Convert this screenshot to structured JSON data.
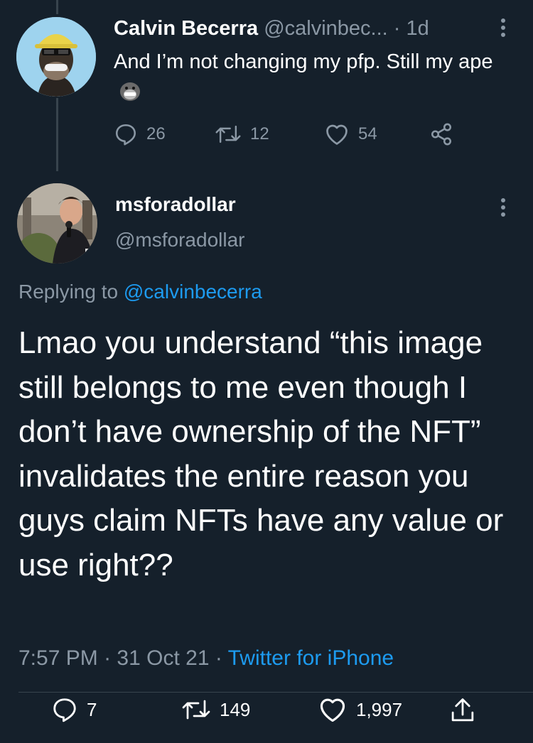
{
  "parent_tweet": {
    "display_name": "Calvin Becerra",
    "handle": "@calvinbec...",
    "separator": "·",
    "time": "1d",
    "text": "And I’m not changing my pfp. Still my ape",
    "stats": {
      "replies": "26",
      "retweets": "12",
      "likes": "54"
    }
  },
  "main_tweet": {
    "display_name": "msforadollar",
    "handle": "@msforadollar",
    "replying_prefix": "Replying to",
    "replying_handle": "@calvinbecerra",
    "text": "Lmao you understand “this image still belongs to me even though I don’t have ownership of the NFT” invalidates the entire reason you guys claim NFTs have any value or use right??",
    "time": "7:57 PM",
    "date": "31 Oct 21",
    "sep1": "·",
    "sep2": "·",
    "source": "Twitter for iPhone",
    "stats": {
      "replies": "7",
      "retweets": "149",
      "likes": "1,997"
    }
  },
  "icons": {
    "reply": "reply-icon",
    "retweet": "retweet-icon",
    "like": "heart-icon",
    "share": "share-icon",
    "more": "more-icon"
  },
  "colors": {
    "background": "#15202b",
    "text": "#ffffff",
    "muted": "#8b98a5",
    "link": "#1d9bf0",
    "divider": "#38444d"
  }
}
